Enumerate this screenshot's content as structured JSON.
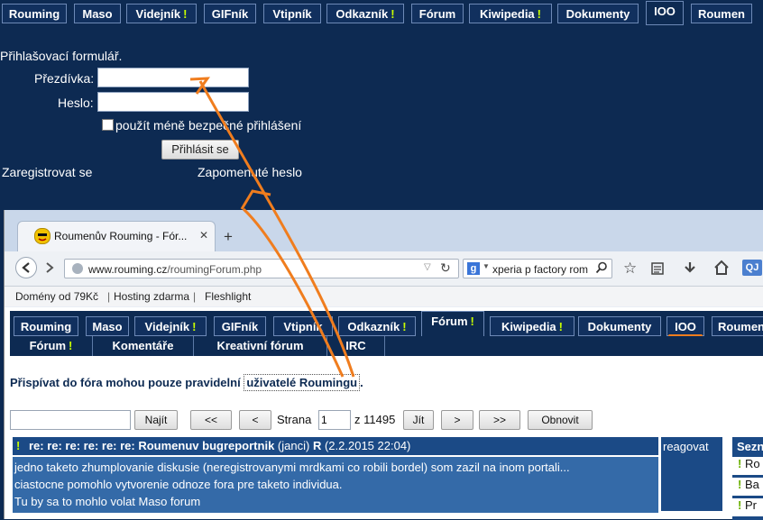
{
  "top_tabs": [
    {
      "label": "Rouming",
      "excl": ""
    },
    {
      "label": "Maso",
      "excl": ""
    },
    {
      "label": "Videjník",
      "excl": "!"
    },
    {
      "label": "GIFník",
      "excl": ""
    },
    {
      "label": "Vtipník",
      "excl": ""
    },
    {
      "label": "Odkazník",
      "excl": "!"
    },
    {
      "label": "Fórum",
      "excl": ""
    },
    {
      "label": "Kiwipedia",
      "excl": "!"
    },
    {
      "label": "Dokumenty",
      "excl": ""
    },
    {
      "label": "IOO",
      "excl": ""
    },
    {
      "label": "Roumen",
      "excl": ""
    }
  ],
  "login": {
    "title": "Přihlašovací formulář.",
    "nick_label": "Přezdívka:",
    "password_label": "Heslo:",
    "less_secure_label": "použít méně bezpečné přihlášení",
    "submit_label": "Přihlásit se",
    "register_link": "Zaregistrovat se",
    "forgot_link": "Zapomenuté heslo"
  },
  "browser": {
    "tab_title": "Roumenův Rouming - Fór...",
    "tab_close": "✕",
    "new_tab": "+",
    "url_domain": "www.rouming.cz",
    "url_path": "/roumingForum.php",
    "search_engine": "g",
    "search_value": "xperia p factory rom",
    "bookmarks": [
      "Domény od 79Kč",
      "Hosting zdarma",
      "Fleshlight"
    ],
    "qj": "QJ"
  },
  "inner_tabs": [
    {
      "label": "Rouming",
      "excl": ""
    },
    {
      "label": "Maso",
      "excl": ""
    },
    {
      "label": "Videjník",
      "excl": "!"
    },
    {
      "label": "GIFník",
      "excl": ""
    },
    {
      "label": "Vtipník",
      "excl": ""
    },
    {
      "label": "Odkazník",
      "excl": "!"
    },
    {
      "label": "Fórum",
      "excl": "!"
    },
    {
      "label": "Kiwipedia",
      "excl": "!"
    },
    {
      "label": "Dokumenty",
      "excl": ""
    },
    {
      "label": "IOO",
      "excl": ""
    },
    {
      "label": "Roumen",
      "excl": ""
    }
  ],
  "subnav": [
    {
      "label": "Fórum",
      "excl": "!"
    },
    {
      "label": "Komentáře",
      "excl": ""
    },
    {
      "label": "Kreativní fórum",
      "excl": ""
    },
    {
      "label": "IRC",
      "excl": ""
    }
  ],
  "forum": {
    "notice_prefix": "Přispívat do fóra mohou pouze pravidelní ",
    "notice_link": "uživatelé Roumingu",
    "notice_suffix": ".",
    "find_label": "Najít",
    "first_label": "<<",
    "prev_label": "<",
    "page_label": "Strana",
    "page_value": "1",
    "of_label": "z 11495",
    "go_label": "Jít",
    "next_label": ">",
    "last_label": ">>",
    "refresh_label": "Obnovit"
  },
  "post": {
    "excl": "!",
    "title": "re: re: re: re: re: re: Roumenuv bugreportnik",
    "author": "(janci)",
    "badge": "R",
    "date": "(2.2.2015 22:04)",
    "lines": [
      "jedno taketo zhumplovanie diskusie (neregistrovanymi mrdkami co robili bordel) som zazil na inom portali...",
      "ciastocne pomohlo vytvorenie odnoze fora pre taketo individua.",
      "Tu by sa to mohlo volat Maso forum"
    ],
    "reply_label": "reagovat"
  },
  "right_panel": {
    "title": "Sezn",
    "items": [
      {
        "excl": "!",
        "label": "Ro"
      },
      {
        "excl": "!",
        "label": "Ba"
      },
      {
        "excl": "!",
        "label": "Pr"
      }
    ]
  },
  "colors": {
    "nav_bg": "#0d2a52",
    "tab_bg": "#11305e",
    "accent_orange": "#f07d1e",
    "excl_green": "#c8ff00",
    "post_body": "#346aa8"
  }
}
